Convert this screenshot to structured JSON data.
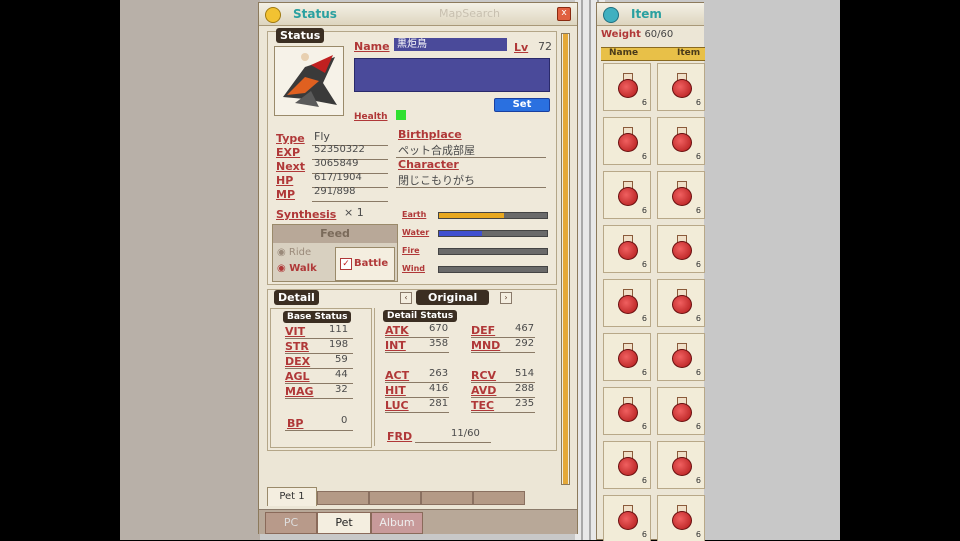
{
  "status_window": {
    "title": "Status",
    "faded_title": "MapSearch",
    "close": "x",
    "status_tag": "Status",
    "name_label": "Name",
    "name_value": "黒炬鳥",
    "lv_label": "Lv",
    "lv_value": "72",
    "set_button": "Set",
    "health_label": "Health",
    "type_label": "Type",
    "type_value": "Fly",
    "exp_label": "EXP",
    "exp_value": "52350322",
    "next_label": "Next",
    "next_value": "3065849",
    "hp_label": "HP",
    "hp_value": "617/1904",
    "mp_label": "MP",
    "mp_value": "291/898",
    "synthesis_label": "Synthesis",
    "synthesis_value": "× 1",
    "birthplace_label": "Birthplace",
    "birthplace_value": "ペット合成部屋",
    "character_label": "Character",
    "character_value": "閉じこもりがち",
    "feed_button": "Feed",
    "ride_label": "Ride",
    "walk_label": "Walk",
    "battle_label": "Battle",
    "elements": [
      {
        "name": "Earth",
        "fill": 0.6,
        "color": "#e8a820"
      },
      {
        "name": "Water",
        "fill": 0.4,
        "color": "#4050d0"
      },
      {
        "name": "Fire",
        "fill": 0.0,
        "color": "#d04020"
      },
      {
        "name": "Wind",
        "fill": 0.0,
        "color": "#30a030"
      }
    ],
    "detail_tag": "Detail",
    "original_tag": "Original",
    "base_status_tag": "Base Status",
    "detail_status_tag": "Detail Status",
    "base_stats": [
      {
        "label": "VIT",
        "value": "111"
      },
      {
        "label": "STR",
        "value": "198"
      },
      {
        "label": "DEX",
        "value": "59"
      },
      {
        "label": "AGL",
        "value": "44"
      },
      {
        "label": "MAG",
        "value": "32"
      }
    ],
    "bp_label": "BP",
    "bp_value": "0",
    "detail_stats_top": [
      {
        "l1": "ATK",
        "v1": "670",
        "l2": "DEF",
        "v2": "467"
      },
      {
        "l1": "INT",
        "v1": "358",
        "l2": "MND",
        "v2": "292"
      }
    ],
    "detail_stats_bottom": [
      {
        "l1": "ACT",
        "v1": "263",
        "l2": "RCV",
        "v2": "514"
      },
      {
        "l1": "HIT",
        "v1": "416",
        "l2": "AVD",
        "v2": "288"
      },
      {
        "l1": "LUC",
        "v1": "281",
        "l2": "TEC",
        "v2": "235"
      }
    ],
    "frd_label": "FRD",
    "frd_value": "11/60",
    "pet_subtab": "Pet 1",
    "tabs": [
      "PC",
      "Pet",
      "Album"
    ]
  },
  "item_window": {
    "title": "Item",
    "weight_label": "Weight",
    "weight_value": "60/60",
    "col_name": "Name",
    "col_item": "Item",
    "count": "6"
  }
}
